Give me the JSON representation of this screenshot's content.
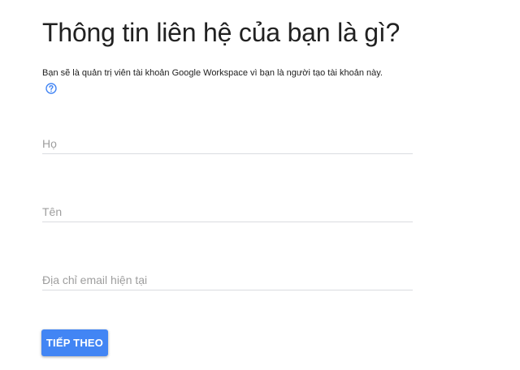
{
  "heading": {
    "title": "Thông tin liên hệ của bạn là gì?",
    "subtitle": "Bạn sẽ là quản trị viên tài khoản Google Workspace vì bạn là người tạo tài khoản này."
  },
  "help": {
    "icon": "help-circle-icon"
  },
  "form": {
    "last_name_placeholder": "Họ",
    "last_name_value": "",
    "first_name_placeholder": "Tên",
    "first_name_value": "",
    "email_placeholder": "Địa chỉ email hiện tại",
    "email_value": ""
  },
  "actions": {
    "next_label": "TIẾP THEO"
  },
  "colors": {
    "accent": "#4285f4",
    "text": "#212121",
    "placeholder": "#9e9e9e",
    "divider": "#dadce0"
  }
}
